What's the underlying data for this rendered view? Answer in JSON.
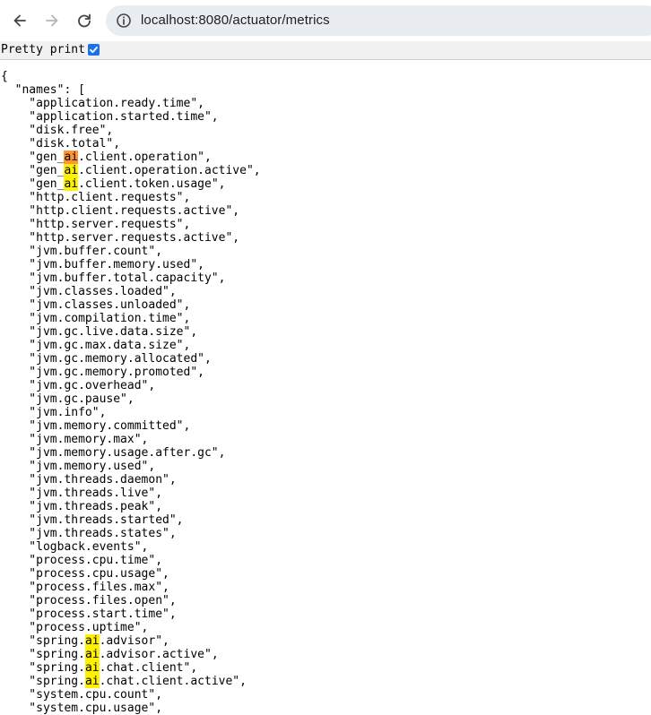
{
  "browser": {
    "url": "localhost:8080/actuator/metrics",
    "icons": [
      "back-arrow-icon",
      "forward-arrow-icon",
      "reload-icon",
      "info-icon"
    ]
  },
  "pretty_print": {
    "label": "Pretty print",
    "checked": true
  },
  "search": {
    "term": "ai",
    "highlight_color": "#fff200",
    "current_color": "#ff9632"
  },
  "json": {
    "open_brace": "{",
    "key": "names",
    "names": [
      "application.ready.time",
      "application.started.time",
      "disk.free",
      "disk.total",
      "gen_ai.client.operation",
      "gen_ai.client.operation.active",
      "gen_ai.client.token.usage",
      "http.client.requests",
      "http.client.requests.active",
      "http.server.requests",
      "http.server.requests.active",
      "jvm.buffer.count",
      "jvm.buffer.memory.used",
      "jvm.buffer.total.capacity",
      "jvm.classes.loaded",
      "jvm.classes.unloaded",
      "jvm.compilation.time",
      "jvm.gc.live.data.size",
      "jvm.gc.max.data.size",
      "jvm.gc.memory.allocated",
      "jvm.gc.memory.promoted",
      "jvm.gc.overhead",
      "jvm.gc.pause",
      "jvm.info",
      "jvm.memory.committed",
      "jvm.memory.max",
      "jvm.memory.usage.after.gc",
      "jvm.memory.used",
      "jvm.threads.daemon",
      "jvm.threads.live",
      "jvm.threads.peak",
      "jvm.threads.started",
      "jvm.threads.states",
      "logback.events",
      "process.cpu.time",
      "process.cpu.usage",
      "process.files.max",
      "process.files.open",
      "process.start.time",
      "process.uptime",
      "spring.ai.advisor",
      "spring.ai.advisor.active",
      "spring.ai.chat.client",
      "spring.ai.chat.client.active",
      "system.cpu.count",
      "system.cpu.usage"
    ]
  }
}
